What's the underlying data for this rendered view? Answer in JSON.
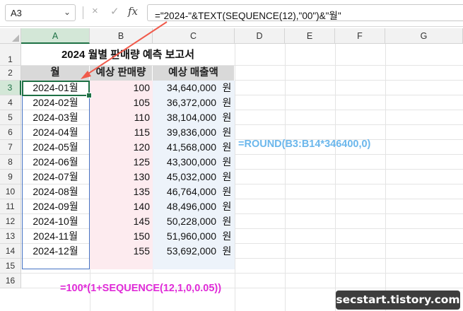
{
  "formula_bar": {
    "name_box": "A3",
    "cancel_icon": "×",
    "enter_icon": "✓",
    "function_icon": "fx",
    "formula": "=\"2024-\"&TEXT(SEQUENCE(12),\"00\")&\"월\""
  },
  "columns": [
    "A",
    "B",
    "C",
    "D",
    "E",
    "F",
    "G"
  ],
  "rows": [
    "1",
    "2",
    "3",
    "4",
    "5",
    "6",
    "7",
    "8",
    "9",
    "10",
    "11",
    "12",
    "13",
    "14",
    "15",
    "16"
  ],
  "sheet": {
    "title": "2024 월별 판매량 예측 보고서",
    "headers": [
      "월",
      "예상 판매량",
      "예상 매출액"
    ],
    "data": [
      {
        "month": "2024-01월",
        "qty": "100",
        "amount": "34,640,000",
        "unit": "원"
      },
      {
        "month": "2024-02월",
        "qty": "105",
        "amount": "36,372,000",
        "unit": "원"
      },
      {
        "month": "2024-03월",
        "qty": "110",
        "amount": "38,104,000",
        "unit": "원"
      },
      {
        "month": "2024-04월",
        "qty": "115",
        "amount": "39,836,000",
        "unit": "원"
      },
      {
        "month": "2024-05월",
        "qty": "120",
        "amount": "41,568,000",
        "unit": "원"
      },
      {
        "month": "2024-06월",
        "qty": "125",
        "amount": "43,300,000",
        "unit": "원"
      },
      {
        "month": "2024-07월",
        "qty": "130",
        "amount": "45,032,000",
        "unit": "원"
      },
      {
        "month": "2024-08월",
        "qty": "135",
        "amount": "46,764,000",
        "unit": "원"
      },
      {
        "month": "2024-09월",
        "qty": "140",
        "amount": "48,496,000",
        "unit": "원"
      },
      {
        "month": "2024-10월",
        "qty": "145",
        "amount": "50,228,000",
        "unit": "원"
      },
      {
        "month": "2024-11월",
        "qty": "150",
        "amount": "51,960,000",
        "unit": "원"
      },
      {
        "month": "2024-12월",
        "qty": "155",
        "amount": "53,692,000",
        "unit": "원"
      }
    ]
  },
  "annotations": {
    "round_formula": "=ROUND(B3:B14*346400,0)",
    "sequence_formula": "=100*(1+SEQUENCE(12,1,0,0.05))",
    "arrow_color": "#f05a4b",
    "round_color": "#6bb7ec",
    "sequence_color": "#e02bd8"
  },
  "watermark": "secstart.tistory.com"
}
